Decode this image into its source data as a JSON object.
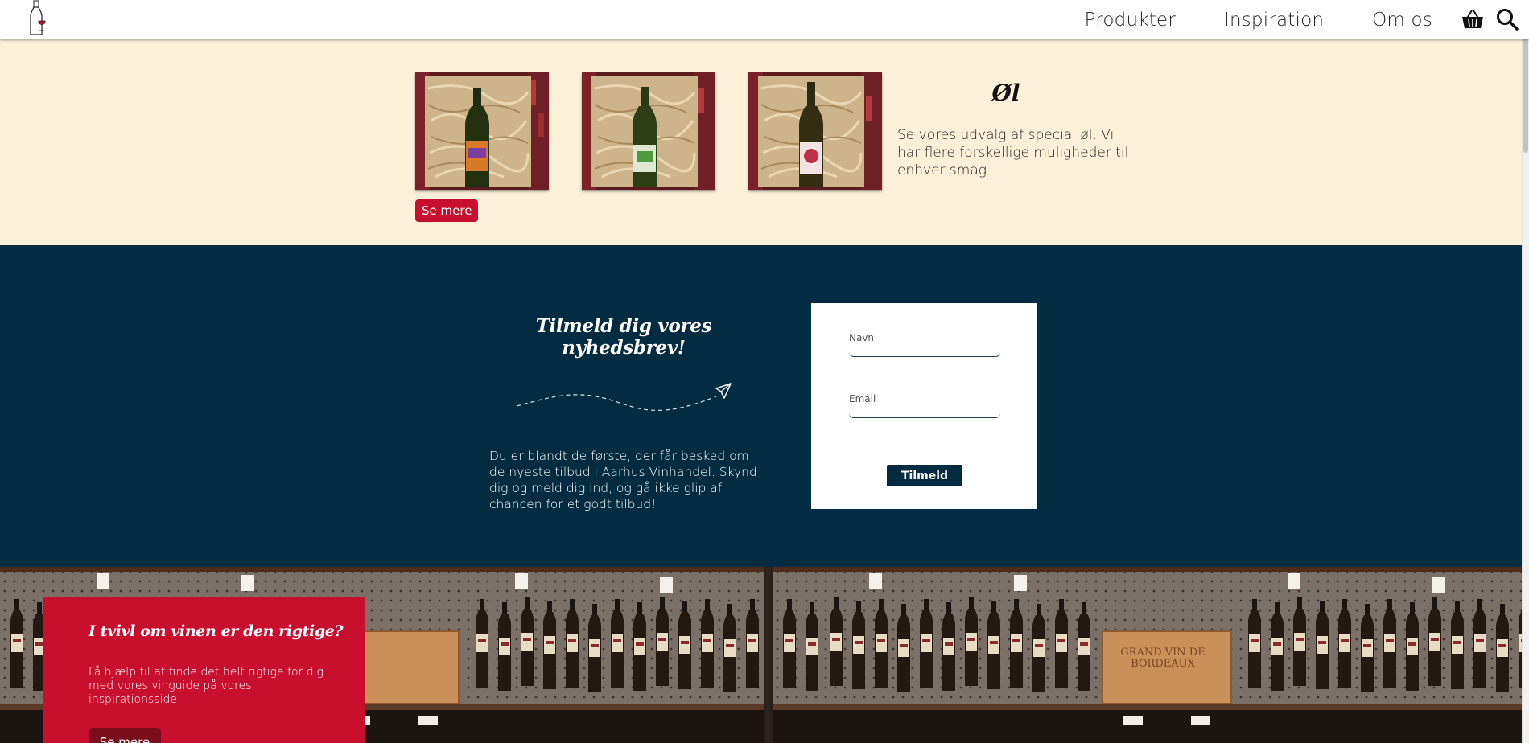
{
  "header": {
    "logo_icon": "wine-bottle-glass-icon",
    "nav": [
      "Produkter",
      "Inspiration",
      "Om os"
    ],
    "basket_icon": "shopping-basket-icon",
    "search_icon": "search-icon"
  },
  "beer_section": {
    "title": "Øl",
    "description": "Se vores udvalg af special øl. Vi har flere forskellige muligheder til enhver smag.",
    "button": "Se mere",
    "images": [
      "beer-bottle-orange-label",
      "beer-bottle-green-label",
      "beer-bottle-pink-label"
    ]
  },
  "newsletter": {
    "title": "Tilmeld dig vores nyhedsbrev!",
    "description": "Du er blandt de første, der får besked om de nyeste tilbud i Aarhus Vinhandel. Skynd dig og meld dig ind, og gå ikke glip af chancen for et godt tilbud!",
    "icon": "paper-plane-icon",
    "form": {
      "name_label": "Navn",
      "name_value": "",
      "email_label": "Email",
      "email_value": "",
      "submit": "Tilmeld"
    }
  },
  "wine_guide": {
    "title": "I tvivl om vinen er den rigtige?",
    "description": "Få hjælp til at finde det helt rigtige for dig med vores vinguide på vores inspirationsside",
    "button": "Se mere",
    "shelf_sign": "GRAND VIN DE BORDEAUX"
  },
  "colors": {
    "accent_red": "#c8102e",
    "navy": "#032c42",
    "cream": "#fdf0d9"
  }
}
